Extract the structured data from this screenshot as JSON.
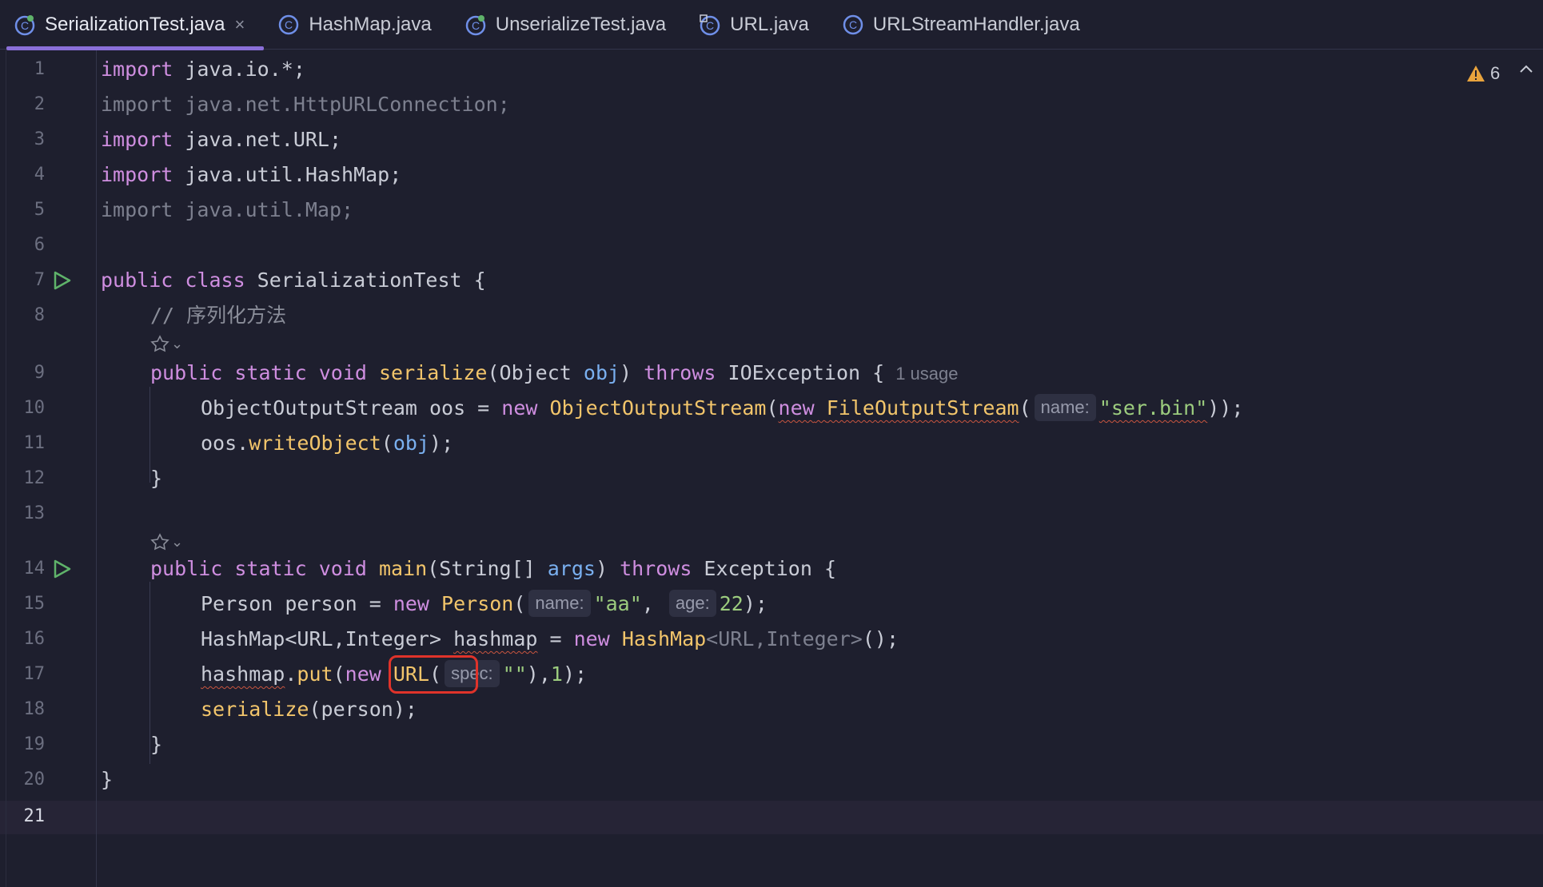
{
  "tabs": [
    {
      "label": "SerializationTest.java",
      "active": true,
      "icon": "class-icon",
      "close": "×"
    },
    {
      "label": "HashMap.java",
      "active": false,
      "icon": "class-icon"
    },
    {
      "label": "UnserializeTest.java",
      "active": false,
      "icon": "class-icon"
    },
    {
      "label": "URL.java",
      "active": false,
      "icon": "class-icon"
    },
    {
      "label": "URLStreamHandler.java",
      "active": false,
      "icon": "class-icon"
    }
  ],
  "inspections": {
    "warning_count": "6",
    "icon": "warning-icon"
  },
  "line_numbers": [
    "1",
    "2",
    "3",
    "4",
    "5",
    "6",
    "7",
    "8",
    "9",
    "10",
    "11",
    "12",
    "13",
    "14",
    "15",
    "16",
    "17",
    "18",
    "19",
    "20",
    "21"
  ],
  "code": {
    "l1": {
      "kw": "import",
      "rest": " java.io.*;"
    },
    "l2": {
      "text": "import java.net.HttpURLConnection;"
    },
    "l3": {
      "kw": "import",
      "rest": " java.net.URL;"
    },
    "l4": {
      "kw": "import",
      "rest": " java.util.HashMap;"
    },
    "l5": {
      "text": "import java.util.Map;"
    },
    "l7": {
      "kw": "public class",
      "rest": " SerializationTest {"
    },
    "l8": {
      "comment": "// 序列化方法"
    },
    "l9": {
      "kw": "public static void",
      "fn": "serialize",
      "a": "(Object ",
      "param": "obj",
      "b": ") ",
      "kw2": "throws",
      "c": " IOException {",
      "usage": "1 usage"
    },
    "l10": {
      "a": "ObjectOutputStream oos = ",
      "kw": "new",
      "fn": "ObjectOutputStream",
      "b": "(",
      "kw2": "new",
      "fn2": "FileOutputStream",
      "c": "(",
      "hint": "name:",
      "str": "\"ser.bin\"",
      "d": "));"
    },
    "l11": {
      "a": "oos.",
      "fn": "writeObject",
      "b": "(",
      "param": "obj",
      "c": ");"
    },
    "l12": {
      "text": "}"
    },
    "l14": {
      "kw": "public static void",
      "fn": "main",
      "a": "(String[] ",
      "param": "args",
      "b": ") ",
      "kw2": "throws",
      "c": " Exception {"
    },
    "l15": {
      "a": "Person person = ",
      "kw": "new",
      "fn": "Person",
      "b": "(",
      "hint1": "name:",
      "str": "\"aa\"",
      "c": ", ",
      "hint2": "age:",
      "num": "22",
      "d": ");"
    },
    "l16": {
      "a": "HashMap<URL,Integer> ",
      "var": "hashmap",
      "b": " = ",
      "kw": "new",
      "fn": "HashMap",
      "dim": "<URL,Integer>",
      "c": "();"
    },
    "l17": {
      "var": "hashmap",
      "a": ".",
      "fn": "put",
      "b": "(",
      "kw": "new",
      "fn2": "URL",
      "c": "(",
      "hint": "spec:",
      "str": "\"\"",
      "d": "),",
      "num": "1",
      "e": ");"
    },
    "l18": {
      "fn": "serialize",
      "a": "(person);"
    },
    "l19": {
      "text": "}"
    },
    "l20": {
      "text": "}"
    }
  },
  "colors": {
    "background": "#1e1f2e",
    "keyword": "#cf8ee0",
    "function": "#f2c56b",
    "string": "#9ccc7e",
    "highlight_box": "#e0332a",
    "tab_active_underline": "#8a6fd8"
  }
}
